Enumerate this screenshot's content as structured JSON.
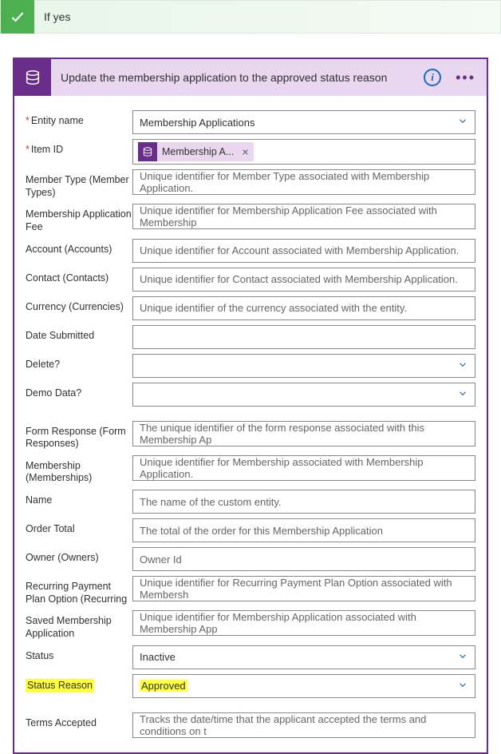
{
  "condition": {
    "label": "If yes"
  },
  "card": {
    "title": "Update the membership application to the approved status reason",
    "fields": {
      "entity_name": {
        "label": "Entity name",
        "value": "Membership Applications",
        "required": true,
        "dropdown": true
      },
      "item_id": {
        "label": "Item ID",
        "token": "Membership A...",
        "required": true
      },
      "member_type": {
        "label": "Member Type (Member Types)",
        "placeholder": "Unique identifier for Member Type associated with Membership Application."
      },
      "app_fee": {
        "label": "Membership Application Fee",
        "placeholder": "Unique identifier for Membership Application Fee associated with Membership"
      },
      "account": {
        "label": "Account (Accounts)",
        "placeholder": "Unique identifier for Account associated with Membership Application."
      },
      "contact": {
        "label": "Contact (Contacts)",
        "placeholder": "Unique identifier for Contact associated with Membership Application."
      },
      "currency": {
        "label": "Currency (Currencies)",
        "placeholder": "Unique identifier of the currency associated with the entity."
      },
      "date_submitted": {
        "label": "Date Submitted",
        "placeholder": ""
      },
      "delete": {
        "label": "Delete?",
        "placeholder": "",
        "dropdown": true
      },
      "demo": {
        "label": "Demo Data?",
        "placeholder": "",
        "dropdown": true
      },
      "form_response": {
        "label": "Form Response (Form Responses)",
        "placeholder": "The unique identifier of the form response associated with this Membership Ap"
      },
      "membership": {
        "label": "Membership (Memberships)",
        "placeholder": "Unique identifier for Membership associated with Membership Application."
      },
      "name": {
        "label": "Name",
        "placeholder": "The name of the custom entity."
      },
      "order_total": {
        "label": "Order Total",
        "placeholder": "The total of the order for this Membership Application"
      },
      "owner": {
        "label": "Owner (Owners)",
        "placeholder": "Owner Id"
      },
      "recurring": {
        "label": "Recurring Payment Plan Option (Recurring",
        "placeholder": "Unique identifier for Recurring Payment Plan Option associated with Membersh"
      },
      "saved": {
        "label": "Saved Membership Application",
        "placeholder": "Unique identifier for Membership Application associated with Membership App"
      },
      "status": {
        "label": "Status",
        "value": "Inactive",
        "dropdown": true
      },
      "status_reason": {
        "label": "Status Reason",
        "value": "Approved",
        "dropdown": true,
        "highlight": true
      },
      "terms": {
        "label": "Terms Accepted",
        "placeholder": "Tracks the date/time that the applicant accepted the terms and conditions on t"
      }
    }
  }
}
